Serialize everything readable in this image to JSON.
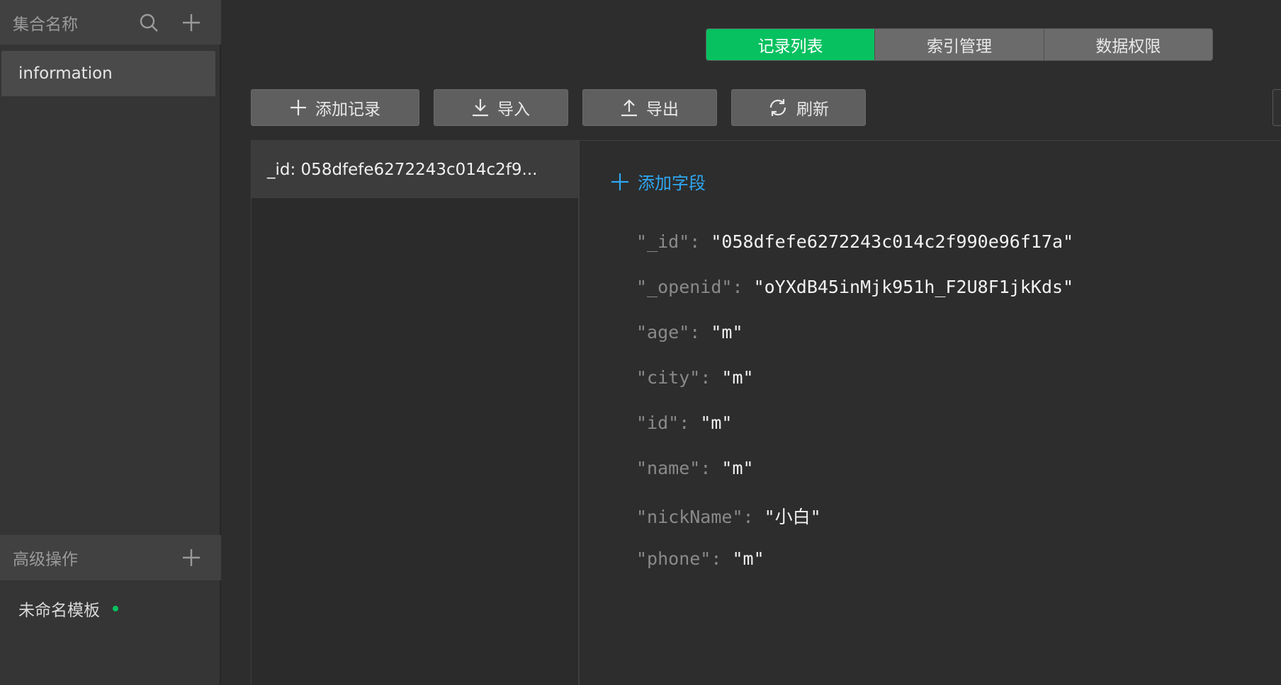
{
  "sidebar": {
    "collections_title": "集合名称",
    "collections": [
      {
        "label": "information"
      }
    ],
    "advanced_title": "高级操作",
    "templates": [
      {
        "label": "未命名模板"
      }
    ]
  },
  "tabs": [
    {
      "label": "记录列表",
      "active": true
    },
    {
      "label": "索引管理",
      "active": false
    },
    {
      "label": "数据权限",
      "active": false
    }
  ],
  "toolbar": {
    "add_record": "添加记录",
    "import": "导入",
    "export": "导出",
    "refresh": "刷新"
  },
  "records": [
    {
      "label": "_id: 058dfefe6272243c014c2f9..."
    }
  ],
  "detail": {
    "add_field_label": "添加字段",
    "fields": [
      {
        "key": "\"_id\"",
        "value": "\"058dfefe6272243c014c2f990e96f17a\""
      },
      {
        "key": "\"_openid\"",
        "value": "\"oYXdB45inMjk951h_F2U8F1jkKds\""
      },
      {
        "key": "\"age\"",
        "value": "\"m\""
      },
      {
        "key": "\"city\"",
        "value": "\"m\""
      },
      {
        "key": "\"id\"",
        "value": "\"m\""
      },
      {
        "key": "\"name\"",
        "value": "\"m\""
      },
      {
        "key": "\"nickName\"",
        "value": "\"小白\""
      },
      {
        "key": "\"phone\"",
        "value": "\"m\""
      }
    ]
  },
  "colors": {
    "accent_green": "#07c160",
    "link_blue": "#2ea7f2",
    "background": "#2d2d2d"
  }
}
